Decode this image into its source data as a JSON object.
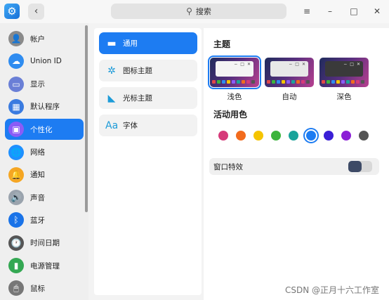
{
  "titlebar": {
    "app_icon": "gear-icon",
    "back_icon": "chevron-left-icon",
    "search_placeholder": "搜索",
    "menu_icon": "≡",
    "minimize_icon": "–",
    "maximize_icon": "□",
    "close_icon": "✕"
  },
  "sidebar": {
    "items": [
      {
        "label": "帐户",
        "icon": "account-icon",
        "color": "#8a8a8a",
        "glyph": "👤"
      },
      {
        "label": "Union ID",
        "icon": "cloud-icon",
        "color": "#2f8cf0",
        "glyph": "☁"
      },
      {
        "label": "显示",
        "icon": "display-icon",
        "color": "#6a7fd6",
        "glyph": "▭"
      },
      {
        "label": "默认程序",
        "icon": "default-apps-icon",
        "color": "#3a7be0",
        "glyph": "▦"
      },
      {
        "label": "个性化",
        "icon": "personalization-icon",
        "color": "#8b5cf6",
        "glyph": "▣"
      },
      {
        "label": "网络",
        "icon": "network-icon",
        "color": "#1e90ff",
        "glyph": "🌐"
      },
      {
        "label": "通知",
        "icon": "bell-icon",
        "color": "#f5a623",
        "glyph": "🔔"
      },
      {
        "label": "声音",
        "icon": "speaker-icon",
        "color": "#9aa3ad",
        "glyph": "🔊"
      },
      {
        "label": "蓝牙",
        "icon": "bluetooth-icon",
        "color": "#1a73e8",
        "glyph": "ᛒ"
      },
      {
        "label": "时间日期",
        "icon": "clock-icon",
        "color": "#555555",
        "glyph": "🕐"
      },
      {
        "label": "电源管理",
        "icon": "battery-icon",
        "color": "#34a853",
        "glyph": "▮"
      },
      {
        "label": "鼠标",
        "icon": "mouse-icon",
        "color": "#777777",
        "glyph": "🖱"
      }
    ],
    "active_index": 4
  },
  "middle": {
    "items": [
      {
        "label": "通用",
        "icon": "general-icon",
        "glyph": "▬"
      },
      {
        "label": "图标主题",
        "icon": "icon-theme-icon",
        "glyph": "✲"
      },
      {
        "label": "光标主题",
        "icon": "cursor-icon",
        "glyph": "◣"
      },
      {
        "label": "字体",
        "icon": "font-icon",
        "glyph": "Aa"
      }
    ],
    "active_index": 0
  },
  "content": {
    "theme_title": "主题",
    "themes": [
      {
        "label": "浅色",
        "window_color": "#f4f4f4"
      },
      {
        "label": "自动",
        "window_color": "#e8e8e8"
      },
      {
        "label": "深色",
        "window_color": "#3a3a3a"
      }
    ],
    "theme_selected_index": 0,
    "accent_title": "活动用色",
    "accent_colors": [
      "#d63a7a",
      "#f26b1d",
      "#f5c400",
      "#3cb43c",
      "#1aa39a",
      "#1d7cf2",
      "#3a1fd6",
      "#8b1fd6",
      "#555555"
    ],
    "accent_selected_index": 5,
    "window_effect_label": "窗口特效",
    "window_effect_on": true
  },
  "watermark": "CSDN @正月十六工作室"
}
